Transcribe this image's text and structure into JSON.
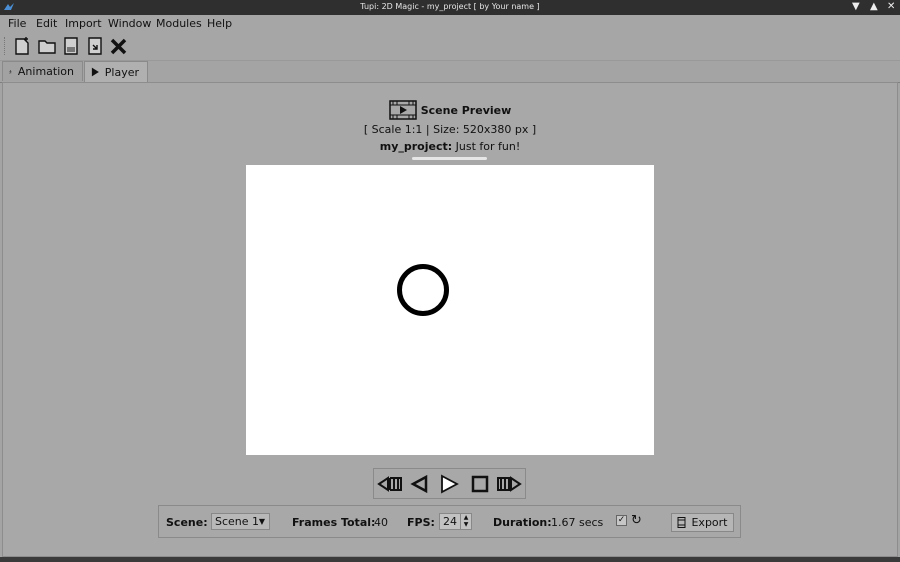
{
  "window": {
    "title": "Tupi: 2D Magic - my_project [ by Your name ]"
  },
  "menu": {
    "items": [
      "File",
      "Edit",
      "Import",
      "Window",
      "Modules",
      "Help"
    ]
  },
  "toolbar": {
    "icons": [
      "new-file-icon",
      "open-folder-icon",
      "save-icon",
      "save-as-icon",
      "close-project-icon"
    ]
  },
  "tabs": [
    {
      "label": "Animation",
      "icon": "animation-icon"
    },
    {
      "label": "Player",
      "icon": "play-icon",
      "active": true
    }
  ],
  "preview": {
    "title": "Scene Preview",
    "size_text": "[ Scale 1:1 | Size: 520x380 px ]",
    "project_name": "my_project:",
    "project_desc": "Just for fun!"
  },
  "status": {
    "scene_label": "Scene:",
    "scene_value": "Scene 1",
    "frames_label": "Frames Total:",
    "frames_value": "40",
    "fps_label": "FPS:",
    "fps_value": "24",
    "duration_label": "Duration:",
    "duration_value": "1.67 secs",
    "export_label": "Export"
  },
  "colors": {
    "background": "#a4a4a4",
    "titlebar": "#2f2f2f",
    "canvas": "#ffffff"
  }
}
